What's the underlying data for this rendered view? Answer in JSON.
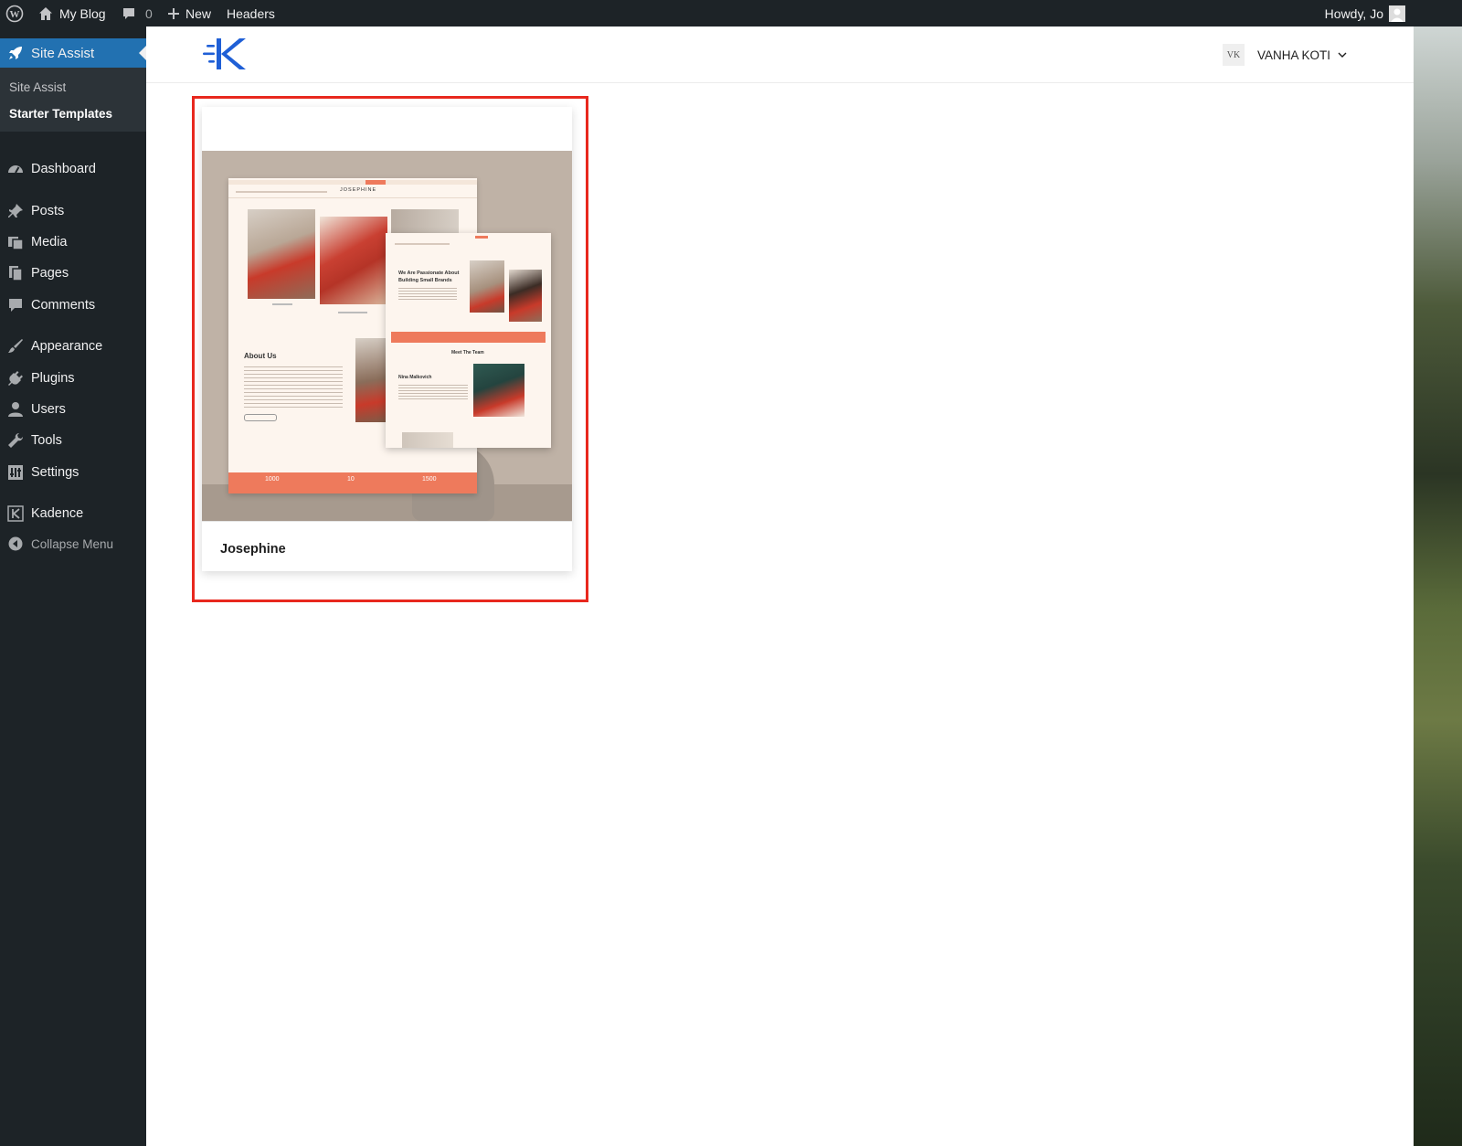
{
  "admin_bar": {
    "site_name": "My Blog",
    "comments_count": "0",
    "new_label": "New",
    "headers_label": "Headers",
    "howdy": "Howdy, Jo"
  },
  "sidebar": {
    "current": "Site Assist",
    "submenu": [
      "Site Assist",
      "Starter Templates"
    ],
    "items": [
      "Dashboard",
      "Posts",
      "Media",
      "Pages",
      "Comments",
      "Appearance",
      "Plugins",
      "Users",
      "Tools",
      "Settings",
      "Kadence"
    ],
    "collapse": "Collapse Menu"
  },
  "header": {
    "site_initials": "VK",
    "site_label": "VANHA KOTI"
  },
  "template_card": {
    "name": "Josephine",
    "preview": {
      "brand": "JOSEPHINE",
      "about_heading": "About Us",
      "passion_heading_1": "We Are Passionate About",
      "passion_heading_2": "Building Small Brands",
      "stats": [
        "1000",
        "10",
        "1500"
      ],
      "team_heading": "Meet The Team",
      "team_member": "Nina Malkovich"
    }
  },
  "colors": {
    "admin_bg": "#1d2327",
    "accent": "#2271b1",
    "highlight": "#e8281e",
    "kadence_blue": "#1f5fd6",
    "template_coral": "#ee7a5c",
    "template_cream": "#fdf5ee"
  }
}
